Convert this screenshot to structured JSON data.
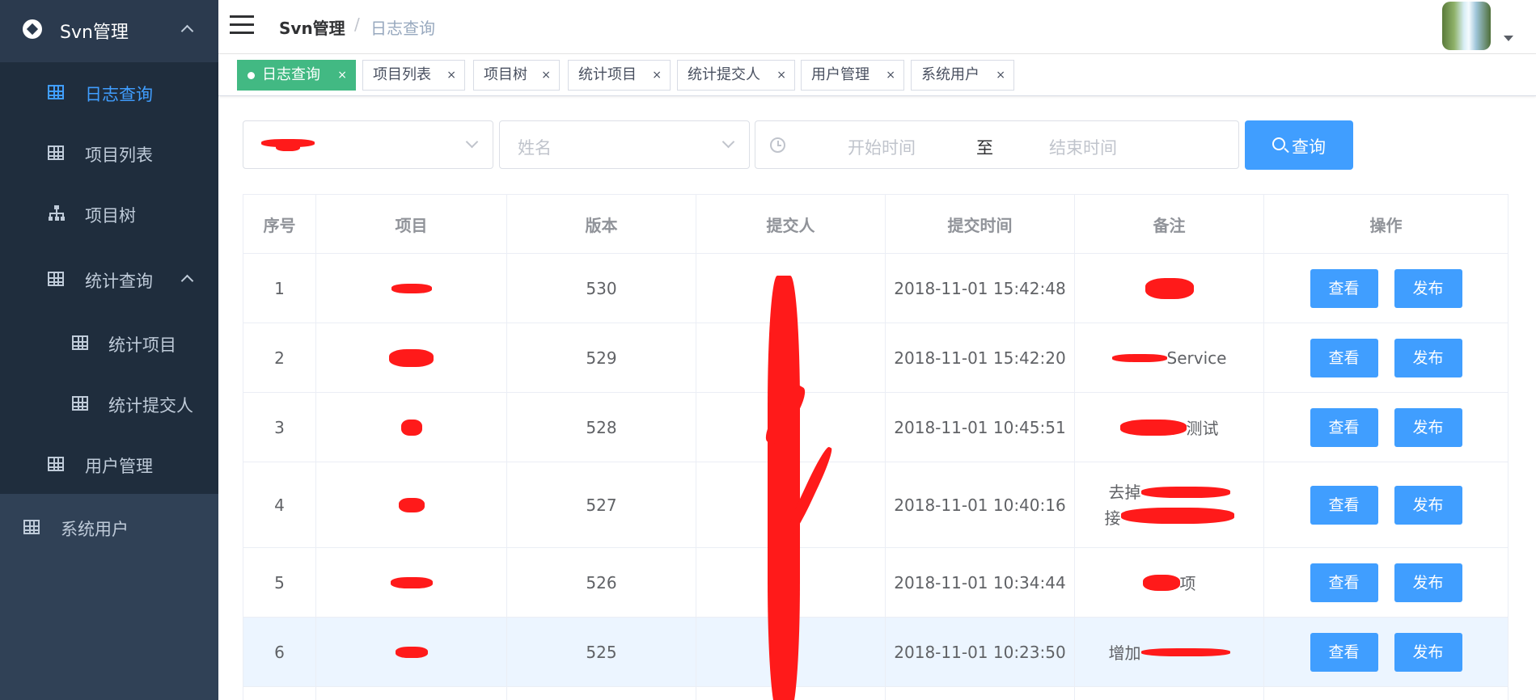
{
  "sidebar": {
    "group_title": "Svn管理",
    "items": [
      {
        "label": "日志查询"
      },
      {
        "label": "项目列表"
      },
      {
        "label": "项目树"
      },
      {
        "label": "统计查询"
      },
      {
        "label": "统计项目"
      },
      {
        "label": "统计提交人"
      },
      {
        "label": "用户管理"
      },
      {
        "label": "系统用户"
      }
    ],
    "active_color": "#409eff",
    "bg_color": "#304156"
  },
  "navbar": {
    "breadcrumb_root": "Svn管理",
    "breadcrumb_sep": "/",
    "breadcrumb_current": "日志查询",
    "menu_icon": "hamburger-icon",
    "avatar_icon": "user-avatar"
  },
  "tags": [
    {
      "label": "日志查询",
      "active": true
    },
    {
      "label": "项目列表"
    },
    {
      "label": "项目树"
    },
    {
      "label": "统计项目"
    },
    {
      "label": "统计提交人"
    },
    {
      "label": "用户管理"
    },
    {
      "label": "系统用户"
    }
  ],
  "tag_close": "×",
  "filters": {
    "name_placeholder": "姓名",
    "start_placeholder": "开始时间",
    "range_sep": "至",
    "end_placeholder": "结束时间",
    "query_label": "查询"
  },
  "table": {
    "headers": [
      "序号",
      "项目",
      "版本",
      "提交人",
      "提交时间",
      "备注",
      "操作"
    ],
    "rows": [
      {
        "no": "1",
        "version": "530",
        "time": "2018-11-01 15:42:48",
        "note": ""
      },
      {
        "no": "2",
        "version": "529",
        "time": "2018-11-01 15:42:20",
        "note": "Service"
      },
      {
        "no": "3",
        "version": "528",
        "time": "2018-11-01 10:45:51",
        "note": "测试"
      },
      {
        "no": "4",
        "version": "527",
        "time": "2018-11-01 10:40:16",
        "note": "去掉",
        "note2": "接"
      },
      {
        "no": "5",
        "version": "526",
        "time": "2018-11-01 10:34:44",
        "note": "项"
      },
      {
        "no": "6",
        "version": "525",
        "time": "2018-11-01 10:23:50",
        "note": "增加"
      }
    ],
    "view_label": "查看",
    "publish_label": "发布"
  },
  "colors": {
    "primary": "#409eff",
    "tag_active": "#42b983",
    "redaction": "#ff1a1a"
  }
}
